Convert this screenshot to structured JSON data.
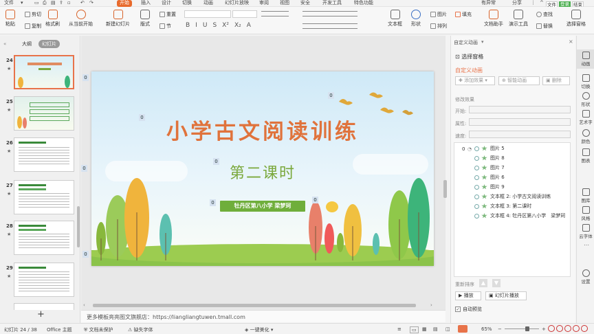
{
  "menu": {
    "file": "文件",
    "tabs": [
      "开始",
      "插入",
      "设计",
      "切换",
      "动画",
      "幻灯片放映",
      "审阅",
      "视图",
      "安全",
      "开发工具",
      "特色功能"
    ],
    "right": [
      "有异常",
      "分享"
    ],
    "user": [
      "文件",
      "登录",
      "结束"
    ]
  },
  "ribbon": {
    "paste": "粘贴",
    "cut": "剪切",
    "copy": "复制",
    "format_painter": "格式刷",
    "play_from_current": "从当前开始",
    "new_slide": "新建幻灯片",
    "layout": "版式",
    "reset": "重置",
    "section": "节",
    "textbox": "文本框",
    "shape": "形状",
    "arrange": "排列",
    "picture": "图片",
    "fill": "填充",
    "doc_assistant": "文档助手",
    "present_tool": "演示工具",
    "find": "查找",
    "replace": "替换",
    "select_pane": "选择窗格"
  },
  "left_panel": {
    "tab_outline": "大纲",
    "tab_slides": "幻灯片",
    "slide_numbers": [
      "24",
      "25",
      "26",
      "27",
      "28",
      "29"
    ],
    "add_button": "+"
  },
  "slide": {
    "title": "小学古文阅读训练",
    "subtitle": "第二课时",
    "author": "牡丹区第八小学  梁梦珂",
    "tag": "0"
  },
  "notes_text": "更多模板亮亮图文旗舰店：https://liangliangtuwen.tmall.com",
  "anim_pane": {
    "header": "自定义动画",
    "select_pane": "选择窗格",
    "section_title": "自定义动画",
    "add_effect": "添加效果",
    "smart_anim": "智能动画",
    "delete": "删除",
    "modify": "修改效果",
    "start_label": "开始:",
    "property_label": "属性:",
    "speed_label": "速度:",
    "index": "0",
    "items": [
      "图片 5",
      "图片 8",
      "图片 7",
      "图片 6",
      "图片 9",
      "文本框 2: 小学古文阅读训练",
      "文本框 3: 第二课时",
      "文本框 4: 牡丹区第八小学　梁梦珂"
    ],
    "reorder": "重新排序",
    "play": "播放",
    "slideshow": "幻灯片播放",
    "autopreview": "自动预览"
  },
  "right_bar": [
    "动画",
    "切换",
    "形状",
    "艺术字",
    "颜色",
    "图表",
    "图库",
    "风格",
    "云字体",
    "设置"
  ],
  "status": {
    "slide_info": "幻灯片 24 / 38",
    "theme": "Office 主题",
    "doc_protect": "文档未保护",
    "missing_font": "缺失字体",
    "beautify": "一键美化",
    "zoom": "65%"
  },
  "colors": {
    "accent": "#e86a2c",
    "title": "#e0733c",
    "subtitle": "#7aa83b",
    "author_bg": "#6fae3b"
  }
}
